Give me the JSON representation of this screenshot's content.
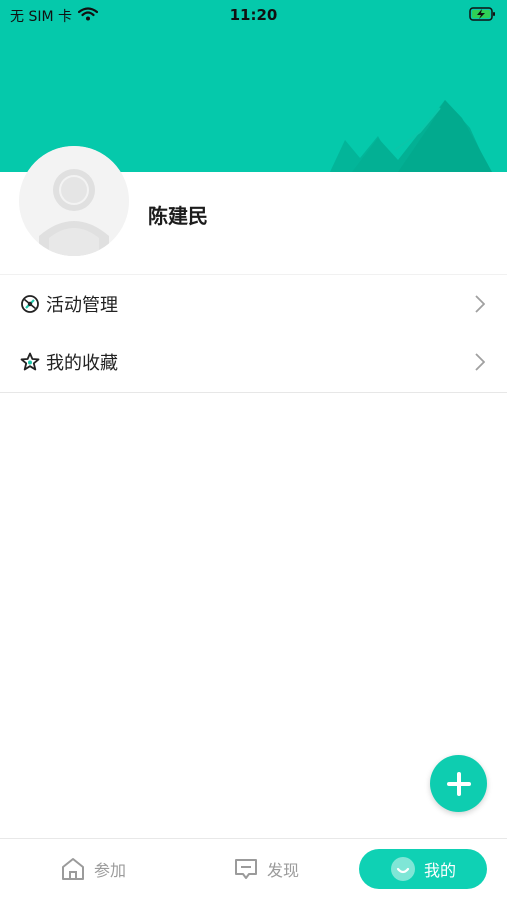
{
  "status_bar": {
    "carrier": "无 SIM 卡",
    "time": "11:20",
    "icons": [
      "wifi-icon",
      "battery-charging-icon"
    ]
  },
  "colors": {
    "header_bg": "#05c9ab",
    "accent": "#0fd1b4",
    "inactive_tab": "#9b9b9b"
  },
  "profile": {
    "name": "陈建民",
    "avatar_icon": "default-avatar-icon"
  },
  "menu": {
    "items": [
      {
        "label": "活动管理",
        "icon": "activity-icon"
      },
      {
        "label": "我的收藏",
        "icon": "star-icon"
      }
    ]
  },
  "fab": {
    "icon": "plus-icon"
  },
  "tabbar": {
    "tabs": [
      {
        "label": "参加",
        "icon": "home-icon",
        "active": false
      },
      {
        "label": "发现",
        "icon": "message-icon",
        "active": false
      },
      {
        "label": "我的",
        "icon": "smile-icon",
        "active": true
      }
    ]
  }
}
